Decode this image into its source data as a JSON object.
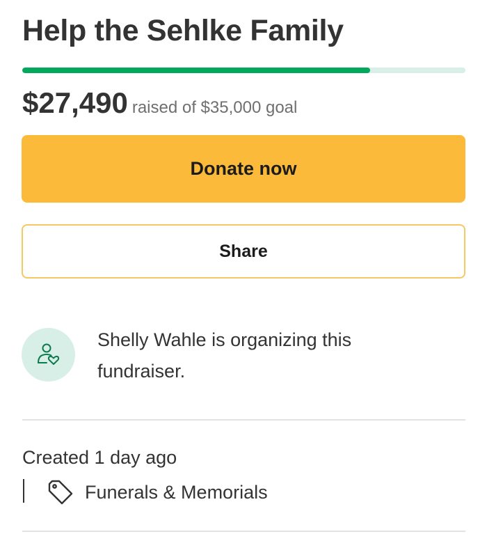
{
  "campaign": {
    "title": "Help the Sehlke Family",
    "progress_fraction": 0.7854,
    "amount_raised": "$27,490",
    "goal_text": "raised of $35,000 goal"
  },
  "actions": {
    "donate_label": "Donate now",
    "share_label": "Share"
  },
  "organizer": {
    "icon": "person-heart-icon",
    "text": "Shelly Wahle is organizing this fundraiser."
  },
  "meta": {
    "created": "Created 1 day ago",
    "category_icon": "tag-icon",
    "category": "Funerals & Memorials"
  },
  "colors": {
    "progress_fill": "#02a95c",
    "progress_track": "#d7efe6",
    "donate_button": "#fbba3a",
    "share_border": "#f6c863",
    "avatar_bg": "#d7efe6",
    "icon_green": "#0b7a4c"
  }
}
